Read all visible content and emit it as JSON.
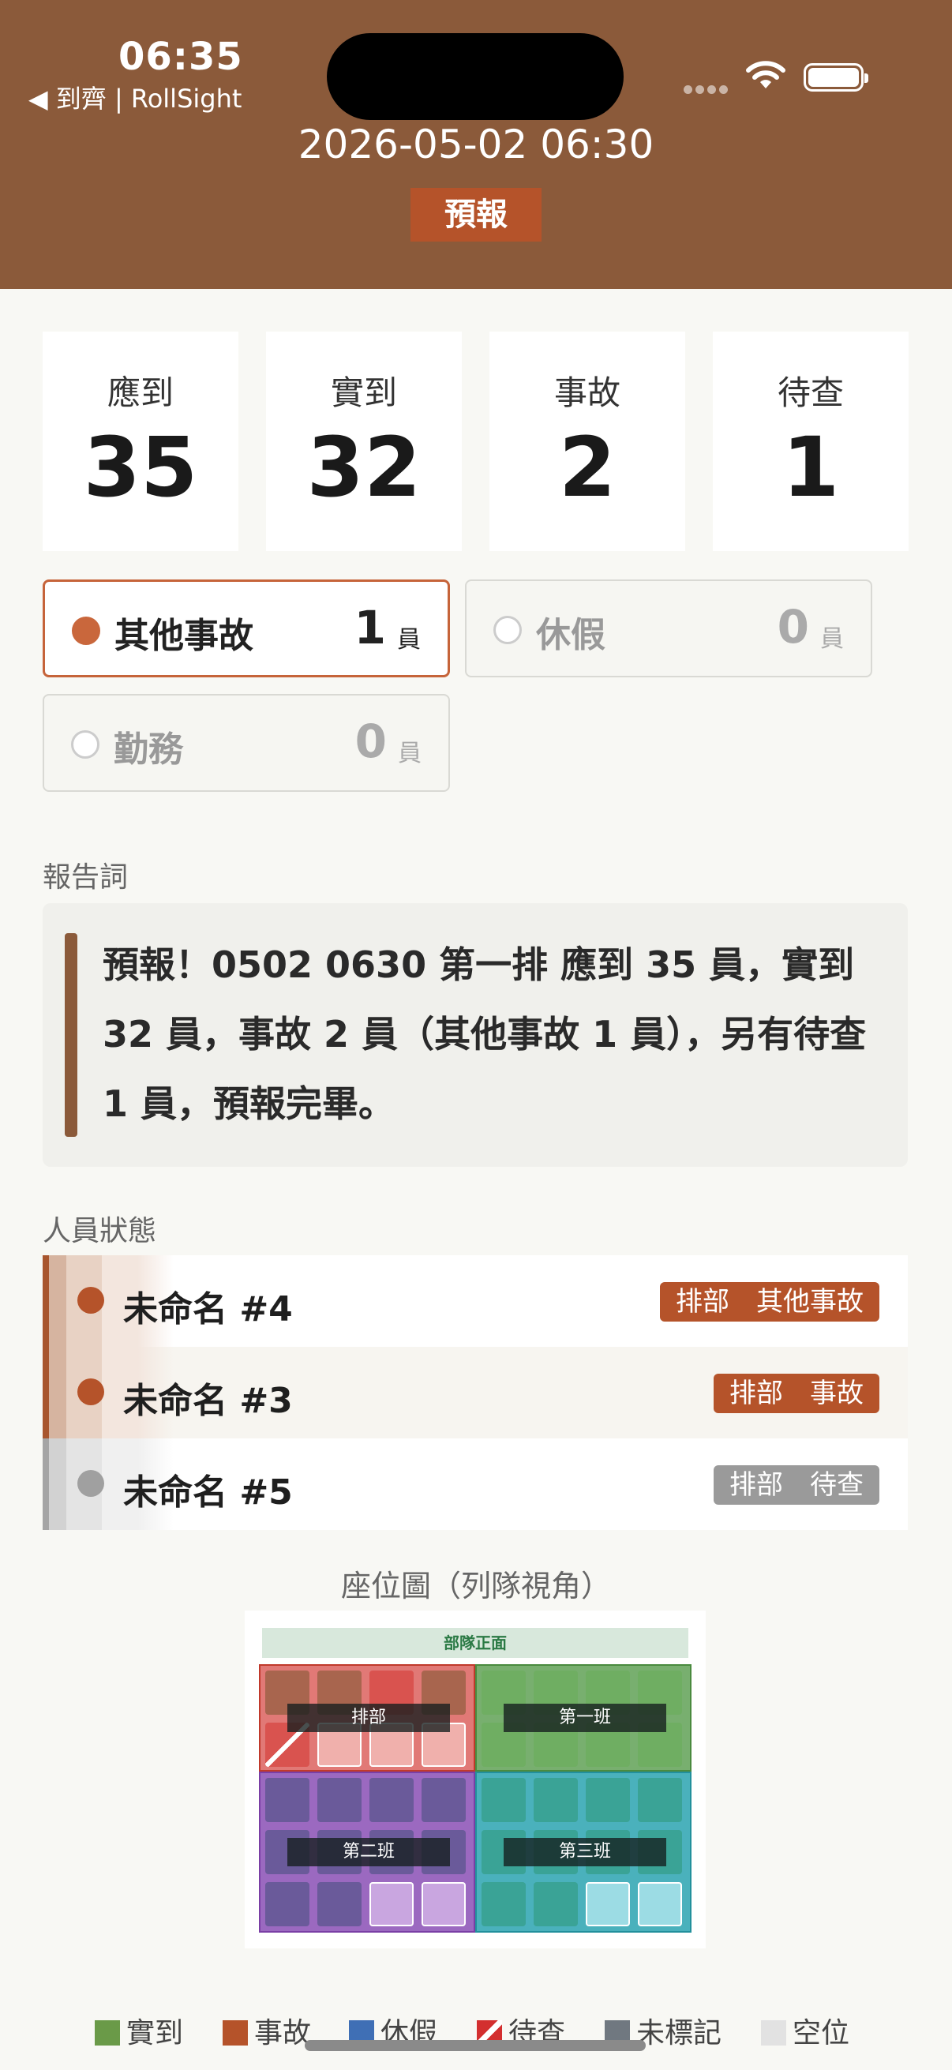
{
  "status_bar": {
    "time": "06:35",
    "back_label": "◀ 到齊 | RollSight"
  },
  "header": {
    "datetime": "2026-05-02 06:30",
    "badge": "預報"
  },
  "stats": [
    {
      "label": "應到",
      "value": "35"
    },
    {
      "label": "實到",
      "value": "32"
    },
    {
      "label": "事故",
      "value": "2"
    },
    {
      "label": "待查",
      "value": "1"
    }
  ],
  "categories": [
    {
      "name": "其他事故",
      "count": "1",
      "unit": "員",
      "active": true
    },
    {
      "name": "休假",
      "count": "0",
      "unit": "員",
      "active": false
    },
    {
      "name": "勤務",
      "count": "0",
      "unit": "員",
      "active": false
    }
  ],
  "report": {
    "section_label": "報告詞",
    "text": "預報！0502 0630 第一排 應到 35 員，實到 32 員，事故 2 員（其他事故 1 員），另有待查 1 員，預報完畢。"
  },
  "personnel": {
    "section_label": "人員狀態",
    "rows": [
      {
        "name": "未命名 #4",
        "tag": "排部　其他事故",
        "color": "#b5532a"
      },
      {
        "name": "未命名 #3",
        "tag": "排部　事故",
        "color": "#b5532a"
      },
      {
        "name": "未命名 #5",
        "tag": "排部　待查",
        "color": "#9a9a9a"
      }
    ]
  },
  "seat_map": {
    "title": "座位圖（列隊視角）",
    "front_label": "部隊正面",
    "groups": [
      {
        "label": "排部",
        "color": "#d9534f"
      },
      {
        "label": "第一班",
        "color": "#5a9e4f"
      },
      {
        "label": "第二班",
        "color": "#8a4fb5"
      },
      {
        "label": "第三班",
        "color": "#2aa3b0"
      }
    ]
  },
  "legend": [
    {
      "label": "實到",
      "color": "#6a9a48"
    },
    {
      "label": "事故",
      "color": "#b5532a"
    },
    {
      "label": "休假",
      "color": "#3f6fb5"
    },
    {
      "label": "待查",
      "color": "#d32f2f"
    },
    {
      "label": "未標記",
      "color": "#707880"
    },
    {
      "label": "空位",
      "color": "#e2e2e2"
    }
  ]
}
